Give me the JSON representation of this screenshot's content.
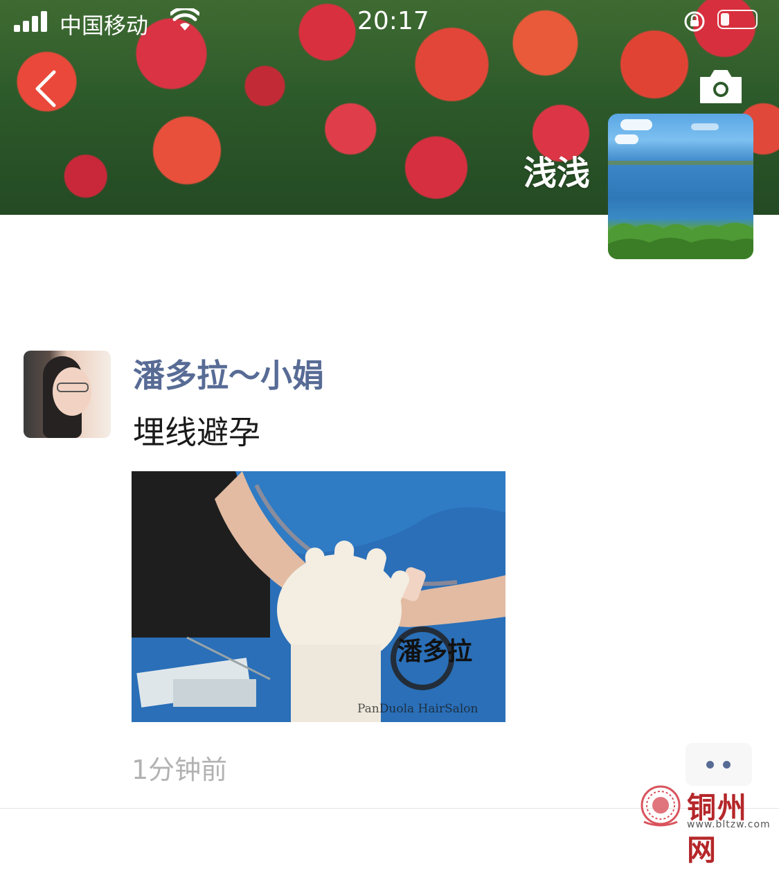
{
  "status_bar": {
    "carrier": "中国移动",
    "time": "20:17"
  },
  "cover": {
    "owner_name": "浅浅"
  },
  "post": {
    "author": "潘多拉～小娟",
    "text": "埋线避孕",
    "image_watermark": "PanDuola HairSalon",
    "image_logo_text": "潘多拉",
    "time": "1分钟前"
  },
  "watermark": {
    "name": "铜州网",
    "url": "www.bltzw.com"
  },
  "icons": {
    "back": "chevron-left-icon",
    "camera": "camera-icon",
    "more": "more-dots-icon"
  }
}
